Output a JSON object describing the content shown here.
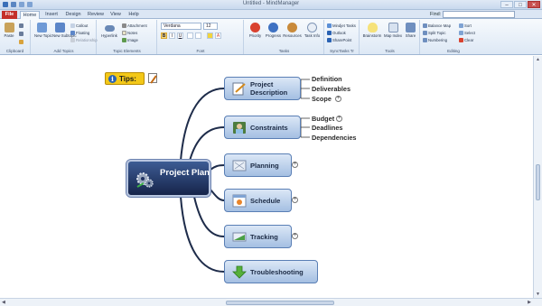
{
  "window": {
    "title": "Untitled - MindManager"
  },
  "tabs": [
    {
      "label": "File"
    },
    {
      "label": "Home"
    },
    {
      "label": "Insert"
    },
    {
      "label": "Design"
    },
    {
      "label": "Review"
    },
    {
      "label": "View"
    },
    {
      "label": "Help"
    }
  ],
  "find": {
    "label": "Find:",
    "value": ""
  },
  "ribbon": {
    "clipboard": {
      "label": "Clipboard",
      "paste": "Paste"
    },
    "add_topics": {
      "label": "Add Topics",
      "new_topic": "New Topic",
      "new_subtopic": "New Subtopic",
      "callout": "Callout",
      "floating": "Floating",
      "relationship": "Relationship"
    },
    "topic_elements": {
      "label": "Topic Elements",
      "hyperlink": "Hyperlink",
      "attachment": "Attachment",
      "notes": "Notes",
      "image": "Image"
    },
    "font": {
      "label": "Font",
      "name": "Verdana",
      "size": "12",
      "bold": "B",
      "italic": "I",
      "underline": "U"
    },
    "tasks": {
      "label": "Tasks",
      "priority": "Priority",
      "progress": "Progress",
      "resources": "Resources",
      "task_info": "Task Info"
    },
    "synctasks": {
      "label": "SyncTasks Tr",
      "mindjet_tasks": "Mindjet Tasks",
      "outlook": "Outlook",
      "sharepoint": "SharePoint"
    },
    "tools": {
      "label": "Tools",
      "brainstorm": "Brainstorm",
      "map_index": "Map Index",
      "share": "Share"
    },
    "editing": {
      "label": "Editing",
      "balance_map": "Balance Map",
      "split_topic": "Split Topic",
      "numbering": "Numbering",
      "sort": "Sort",
      "select": "Select",
      "clear": "Clear"
    }
  },
  "map": {
    "tips": "Tips:",
    "central": "Project Plan",
    "topics": [
      {
        "label": "Project Description",
        "subtopics": [
          "Definition",
          "Deliverables",
          "Scope"
        ]
      },
      {
        "label": "Constraints",
        "subtopics": [
          "Budget",
          "Deadlines",
          "Dependencies"
        ]
      },
      {
        "label": "Planning"
      },
      {
        "label": "Schedule"
      },
      {
        "label": "Tracking"
      },
      {
        "label": "Troubleshooting"
      }
    ]
  },
  "colors": {
    "file_tab": "#c4302b",
    "central_fill": "#1f3260",
    "topic_fill": "#b7cde9",
    "tips_fill": "#f3c818",
    "link": "#1e2c4a"
  }
}
